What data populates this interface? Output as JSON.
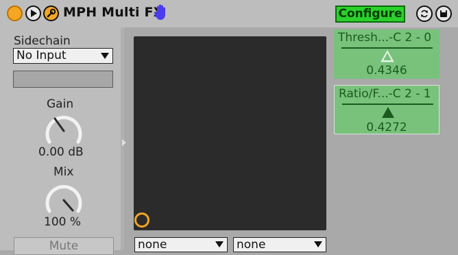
{
  "header": {
    "title": "MPH Multi FX",
    "configure_label": "Configure"
  },
  "sidechain": {
    "label": "Sidechain",
    "input_value": "No Input"
  },
  "gain": {
    "label": "Gain",
    "value": "0.00 dB"
  },
  "mix": {
    "label": "Mix",
    "value": "100 %"
  },
  "mute_label": "Mute",
  "xy_pad": {
    "x_select": "none",
    "y_select": "none"
  },
  "macros": [
    {
      "name": "Thresh...-C 2 - 0",
      "value": "0.4346",
      "filled": false
    },
    {
      "name": "Ratio/F...-C 2 - 1",
      "value": "0.4272",
      "filled": true
    }
  ],
  "colors": {
    "accent_orange": "#f5a623",
    "configure_green": "#2bd12b",
    "macro_green": "#78c27c",
    "pad_background": "#2b2b2b"
  },
  "icons": {
    "device_on": "power-circle-icon",
    "play": "play-icon",
    "wrench": "wrench-icon",
    "hand": "hand-icon",
    "hot_swap": "hot-swap-icon",
    "save": "save-icon"
  }
}
